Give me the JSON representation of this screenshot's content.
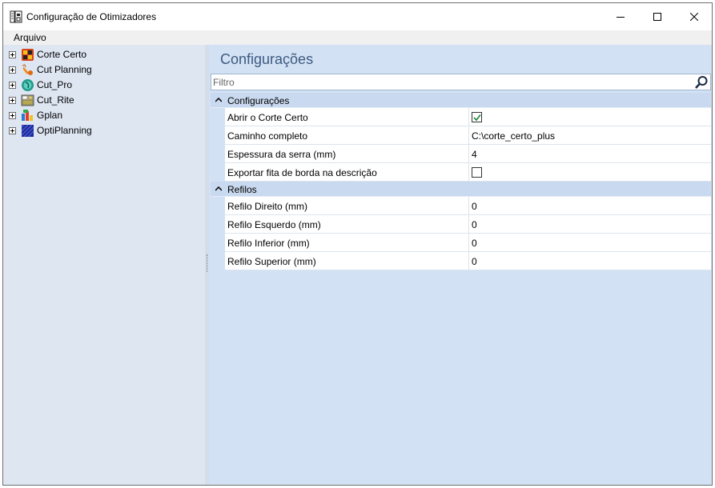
{
  "window": {
    "title": "Configuração de Otimizadores"
  },
  "menu": {
    "items": [
      "Arquivo"
    ]
  },
  "sidebar": {
    "items": [
      {
        "label": "Corte Certo",
        "icon": "corte-certo-icon"
      },
      {
        "label": "Cut Planning",
        "icon": "cut-planning-icon"
      },
      {
        "label": "Cut_Pro",
        "icon": "cut-pro-icon"
      },
      {
        "label": "Cut_Rite",
        "icon": "cut-rite-icon"
      },
      {
        "label": "Gplan",
        "icon": "gplan-icon"
      },
      {
        "label": "OptiPlanning",
        "icon": "optiplanning-icon"
      }
    ]
  },
  "main": {
    "title": "Configurações",
    "filter_placeholder": "Filtro",
    "categories": [
      {
        "label": "Configurações",
        "properties": [
          {
            "name": "Abrir o Corte Certo",
            "type": "checkbox",
            "checked": true
          },
          {
            "name": "Caminho completo",
            "type": "text",
            "value": "C:\\corte_certo_plus"
          },
          {
            "name": "Espessura da serra (mm)",
            "type": "text",
            "value": "4"
          },
          {
            "name": "Exportar fita de borda na descrição",
            "type": "checkbox",
            "checked": false
          }
        ]
      },
      {
        "label": "Refilos",
        "properties": [
          {
            "name": "Refilo Direito (mm)",
            "type": "text",
            "value": "0"
          },
          {
            "name": "Refilo Esquerdo (mm)",
            "type": "text",
            "value": "0"
          },
          {
            "name": "Refilo Inferior (mm)",
            "type": "text",
            "value": "0"
          },
          {
            "name": "Refilo Superior (mm)",
            "type": "text",
            "value": "0"
          }
        ]
      }
    ]
  },
  "colors": {
    "sidebar_bg": "#dee6f2",
    "main_bg": "#d3e1f4",
    "category_bg": "#c9d9ef",
    "title_color": "#3c5a80",
    "check_color": "#2e8b3e"
  }
}
